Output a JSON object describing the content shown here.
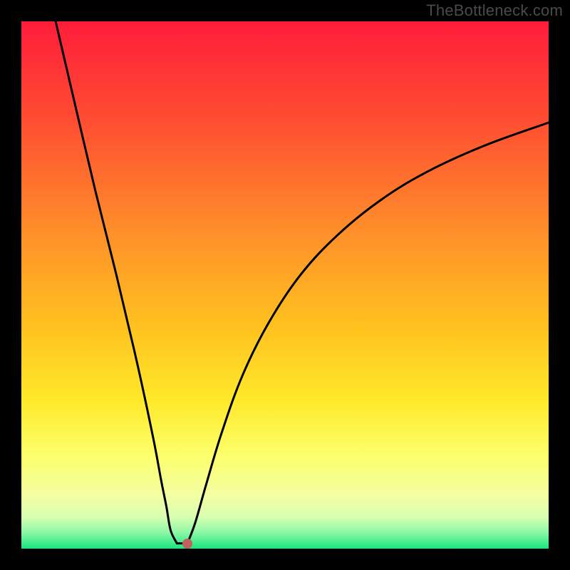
{
  "watermark": "TheBottleneck.com",
  "chart_data": {
    "type": "line",
    "title": "",
    "xlabel": "",
    "ylabel": "",
    "xlim": [
      0,
      100
    ],
    "ylim": [
      0,
      100
    ],
    "gradient_stops": [
      {
        "offset": 0,
        "color": "#ff1d3a"
      },
      {
        "offset": 18,
        "color": "#ff4b32"
      },
      {
        "offset": 40,
        "color": "#ff8f2a"
      },
      {
        "offset": 58,
        "color": "#ffc21f"
      },
      {
        "offset": 72,
        "color": "#ffe92a"
      },
      {
        "offset": 82,
        "color": "#fdff6a"
      },
      {
        "offset": 90,
        "color": "#f3ffa3"
      },
      {
        "offset": 94,
        "color": "#d8ffb0"
      },
      {
        "offset": 97,
        "color": "#8bf7a6"
      },
      {
        "offset": 100,
        "color": "#19e57e"
      }
    ],
    "series": [
      {
        "name": "left-branch",
        "x": [
          6.5,
          10,
          14,
          18,
          22,
          25,
          26.5,
          27.5,
          28.3,
          29.5
        ],
        "y": [
          100,
          85,
          68,
          52,
          35,
          21,
          13,
          8,
          3.5,
          1
        ]
      },
      {
        "name": "floor-segment",
        "x": [
          29.5,
          31.5
        ],
        "y": [
          1,
          1
        ]
      },
      {
        "name": "right-branch",
        "x": [
          31.5,
          33,
          35,
          38,
          42,
          47,
          53,
          60,
          68,
          77,
          88,
          100
        ],
        "y": [
          1,
          5,
          12,
          22,
          33,
          43,
          52,
          59.5,
          66,
          71.5,
          76.5,
          80.8
        ]
      }
    ],
    "marker": {
      "x": 31.5,
      "y": 1,
      "color": "#c0615d"
    }
  }
}
